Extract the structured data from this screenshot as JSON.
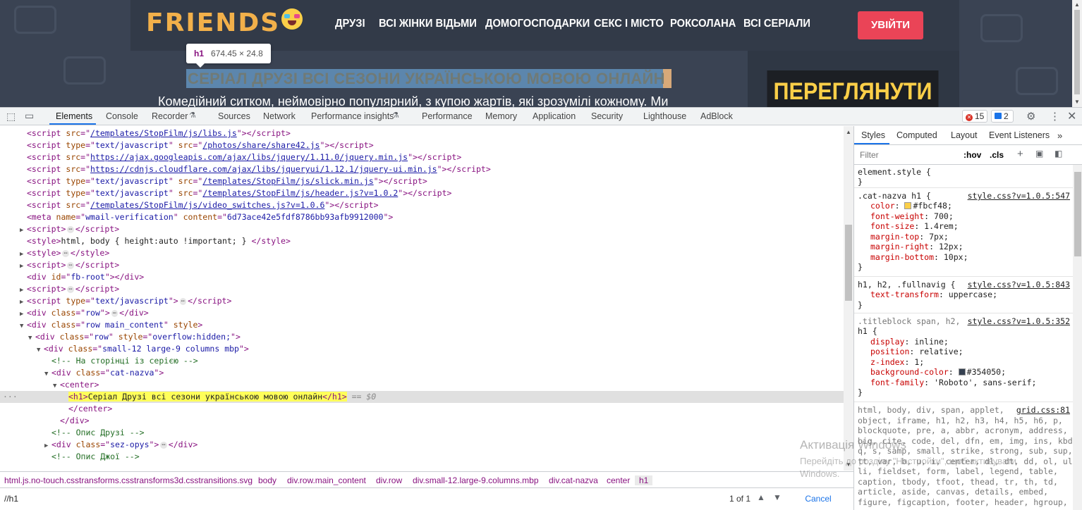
{
  "site": {
    "logo": "FRIENDS",
    "nav": [
      "ДРУЗІ",
      "ВСІ ЖІНКИ ВІДЬМИ",
      "ДОМОГОСПОДАРКИ",
      "СЕКС І МІСТО",
      "РОКСОЛАНА",
      "ВСІ СЕРІАЛИ"
    ],
    "login": "УВІЙТИ",
    "h1": "СЕРІАЛ ДРУЗІ ВСІ СЕЗОНИ УКРАЇНСЬКОЮ МОВОЮ ОНЛАЙН",
    "description": "Комедійний ситком, неймовірно популярний, з купою жартів, які зрозумілі кожному. Ми",
    "watch_banner": "ПЕРЕГЛЯНУТИ",
    "tooltip_tag": "h1",
    "tooltip_size": "674.45 × 24.8"
  },
  "devtools": {
    "tabs": [
      "Elements",
      "Console",
      "Recorder",
      "Sources",
      "Network",
      "Performance insights",
      "Performance",
      "Memory",
      "Application",
      "Security",
      "Lighthouse",
      "AdBlock"
    ],
    "errors": "15",
    "messages": "2",
    "breadcrumbs": [
      "html.js.no-touch.csstransforms.csstransforms3d.csstransitions.svg",
      "body",
      "div.row.main_content",
      "div.row",
      "div.small-12.large-9.columns.mbp",
      "div.cat-nazva",
      "center",
      "h1"
    ],
    "search_value": "//h1",
    "search_count": "1 of 1",
    "cancel": "Cancel"
  },
  "dom": {
    "l1_src": "/templates/StopFilm/js/libs.js",
    "l2_type": "text/javascript",
    "l2_src": "/photos/share/share42.js",
    "l3_src": "https://ajax.googleapis.com/ajax/libs/jquery/1.11.0/jquery.min.js",
    "l4_src": "https://cdnjs.cloudflare.com/ajax/libs/jqueryui/1.12.1/jquery-ui.min.js",
    "l5_src": "/templates/StopFilm/js/slick.min.js",
    "l6_src": "/templates/StopFilm/js/header.js?v=1.0.2",
    "l7_src": "/templates/StopFilm/js/video_switches.js?v=1.0.6",
    "meta_name": "wmail-verification",
    "meta_content": "6d73ace42e5fdf8786bb93afb9912000",
    "style_text": "html, body { height:auto !important; }",
    "fb_root": "fb-root",
    "row": "row",
    "main_content": "row main_content",
    "overflow": "overflow:hidden;",
    "col_class": "small-12 large-9 columns mbp",
    "comment1": "<!-- На сторінці із серією -->",
    "cat_nazva": "cat-nazva",
    "h1_text": "Серіал Друзі всі сезони українською мовою онлайн",
    "comment2": "<!-- Опис Друзі -->",
    "sez_opys": "sez-opys",
    "comment3": "<!-- Опис Джої -->",
    "dollar": "== $0"
  },
  "styles": {
    "tabs": [
      "Styles",
      "Computed",
      "Layout",
      "Event Listeners"
    ],
    "filter_placeholder": "Filter",
    "hov": ":hov",
    "cls": ".cls",
    "element_style": "element.style {",
    "r1_sel": ".cat-nazva h1 {",
    "r1_src": "style.css?v=1.0.5:547",
    "r1_props": [
      [
        "color",
        "#fbcf48"
      ],
      [
        "font-weight",
        "700"
      ],
      [
        "font-size",
        "1.4rem"
      ],
      [
        "margin-top",
        "7px"
      ],
      [
        "margin-right",
        "12px"
      ],
      [
        "margin-bottom",
        "10px"
      ]
    ],
    "r2_sel": "h1, h2, .fullnavig {",
    "r2_src": "style.css?v=1.0.5:843",
    "r2_props": [
      [
        "text-transform",
        "uppercase"
      ]
    ],
    "r3_sel1": ".titleblock span, h2,",
    "r3_sel2": "h1 {",
    "r3_src": "style.css?v=1.0.5:352",
    "r3_props": [
      [
        "display",
        "inline"
      ],
      [
        "position",
        "relative"
      ],
      [
        "z-index",
        "1"
      ],
      [
        "background-color",
        "#354050"
      ],
      [
        "font-family",
        "'Roboto', sans-serif"
      ]
    ],
    "r4_src": "grid.css:81",
    "r4_lines": [
      "html, body, div, span, applet,",
      "object, iframe, h1, h2, h3, h4, h5, h6, p,",
      "blockquote, pre, a, abbr, acronym, address,",
      "big, cite, code, del, dfn, em, img, ins, kbd,",
      "q, s, samp, small, strike, strong, sub, sup,",
      "tt, var, b, u, i, center, dl, dt, dd, ol, ul,",
      "li, fieldset, form, label, legend, table,",
      "caption, tbody, tfoot, thead, tr, th, td,",
      "article, aside, canvas, details, embed,",
      "figure, figcaption, footer, header, hgroup,"
    ]
  },
  "watermark": {
    "title": "Активація Windows",
    "line1": "Перейдіть до розділу \"Настройки\", щоб активувати",
    "line2": "Windows."
  },
  "colors": {
    "accent": "#1a73e8",
    "login": "#ea4457",
    "logo": "#f2b04a",
    "banner_text": "#fbcf48",
    "swatch1": "#fbcf48",
    "swatch2": "#354050"
  }
}
